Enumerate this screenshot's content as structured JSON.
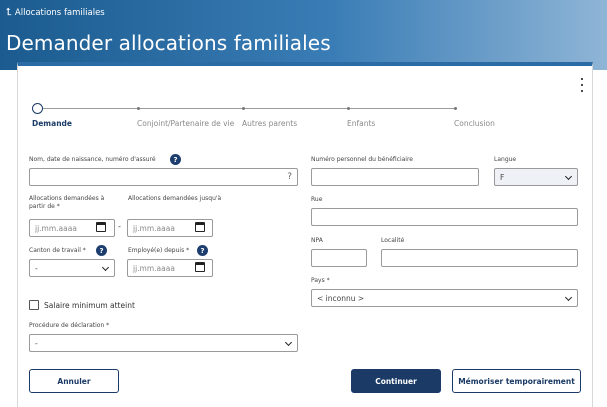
{
  "header": {
    "back_link": "Allocations familiales",
    "title": "Demander allocations familiales"
  },
  "stepper": {
    "steps": [
      {
        "label": "Demande",
        "state": "active"
      },
      {
        "label": "Conjoint/Partenaire de vie",
        "state": "pending"
      },
      {
        "label": "Autres parents",
        "state": "pending"
      },
      {
        "label": "Enfants",
        "state": "pending"
      },
      {
        "label": "Conclusion",
        "state": "pending"
      }
    ]
  },
  "form": {
    "nom_label": "Nom, date de naissance, numéro d'assuré",
    "nom_suffix": "?",
    "numero_beneficiaire_label": "Numéro personnel du bénéficiaire",
    "langue_label": "Langue",
    "langue_value": "F",
    "alloc_from_label": "Allocations demandées à partir de *",
    "alloc_to_label": "Allocations demandées jusqu'à",
    "date_placeholder": "jj.mm.aaaa",
    "date_separator": "-",
    "rue_label": "Rue",
    "canton_label": "Canton de travail *",
    "canton_value": "-",
    "employe_label": "Employé(e) depuis *",
    "npa_label": "NPA",
    "localite_label": "Localité",
    "pays_label": "Pays *",
    "pays_value": "< inconnu >",
    "salaire_label": "Salaire minimum atteint",
    "procedure_label": "Procédure de déclaration *",
    "procedure_value": "-",
    "help_glyph": "?"
  },
  "buttons": {
    "cancel": "Annuler",
    "continue": "Continuer",
    "save_temp": "Mémoriser temporairement"
  },
  "colors": {
    "header_dark": "#1b5b8f",
    "header_light": "#8fb5d6",
    "primary": "#1b3a66"
  },
  "icons": {
    "back": "corner-up-left-icon",
    "more": "kebab-menu-icon",
    "calendar": "calendar-icon",
    "help": "help-circle-icon",
    "chevron": "chevron-down-icon"
  }
}
